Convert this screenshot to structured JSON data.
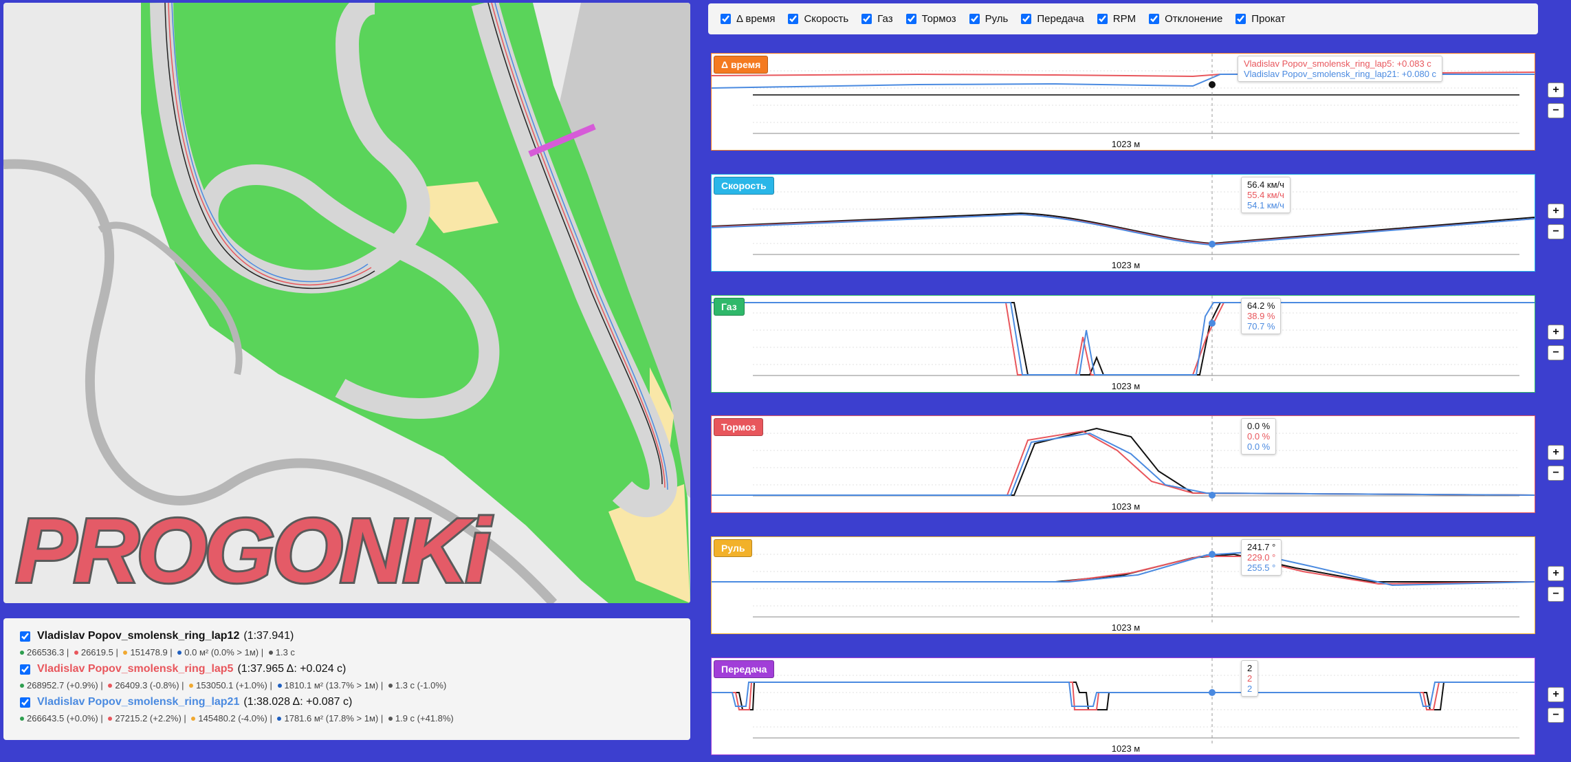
{
  "map": {
    "logo_text": "PROGONKi"
  },
  "laps": [
    {
      "name": "Vladislav Popov_smolensk_ring_lap12",
      "time": "(1:37.941)",
      "color": "#000000",
      "stats": [
        "266536.3",
        "26619.5",
        "151478.9",
        "0.0 м² (0.0% > 1м)",
        "1.3 с"
      ]
    },
    {
      "name": "Vladislav Popov_smolensk_ring_lap5",
      "time": "(1:37.965 Δ: +0.024 с)",
      "color": "#e8565c",
      "stats": [
        "268952.7 (+0.9%)",
        "26409.3 (-0.8%)",
        "153050.1 (+1.0%)",
        "1810.1 м² (13.7% > 1м)",
        "1.3 с (-1.0%)"
      ]
    },
    {
      "name": "Vladislav Popov_smolensk_ring_lap21",
      "time": "(1:38.028 Δ: +0.087 с)",
      "color": "#4a8ae0",
      "stats": [
        "266643.5 (+0.0%)",
        "27215.2 (+2.2%)",
        "145480.2 (-4.0%)",
        "1781.6 м² (17.8% > 1м)",
        "1.9 с (+41.8%)"
      ]
    }
  ],
  "stat_dot_colors": [
    "#2e9e4f",
    "#e8565c",
    "#f0a830",
    "#1f5fbf",
    "#555555"
  ],
  "toolbar": {
    "toggles": [
      "Δ время",
      "Скорость",
      "Газ",
      "Тормоз",
      "Руль",
      "Передача",
      "RPM",
      "Отклонение",
      "Прокат"
    ]
  },
  "x_marker": "1023 м",
  "charts": [
    {
      "title": "Δ время",
      "color": "#f47a20",
      "tooltip": [
        "Vladislav Popov_smolensk_ring_lap5: +0.083 с",
        "Vladislav Popov_smolensk_ring_lap21: +0.080 с"
      ],
      "tooltip_colors": [
        "#e8565c",
        "#4a8ae0"
      ]
    },
    {
      "title": "Скорость",
      "color": "#29b6e8",
      "tooltip": [
        "56.4 км/ч",
        "55.4 км/ч",
        "54.1 км/ч"
      ],
      "tooltip_colors": [
        "#111111",
        "#e8565c",
        "#4a8ae0"
      ]
    },
    {
      "title": "Газ",
      "color": "#2fb86a",
      "tooltip": [
        "64.2 %",
        "38.9 %",
        "70.7 %"
      ],
      "tooltip_colors": [
        "#111111",
        "#e8565c",
        "#4a8ae0"
      ]
    },
    {
      "title": "Тормоз",
      "color": "#e8565c",
      "tooltip": [
        "0.0 %",
        "0.0 %",
        "0.0 %"
      ],
      "tooltip_colors": [
        "#111111",
        "#e8565c",
        "#4a8ae0"
      ]
    },
    {
      "title": "Руль",
      "color": "#f2b12a",
      "tooltip": [
        "241.7 °",
        "229.0 °",
        "255.5 °"
      ],
      "tooltip_colors": [
        "#111111",
        "#e8565c",
        "#4a8ae0"
      ]
    },
    {
      "title": "Передача",
      "color": "#a13ed8",
      "tooltip": [
        "2",
        "2",
        "2"
      ],
      "tooltip_colors": [
        "#111111",
        "#e8565c",
        "#4a8ae0"
      ]
    }
  ],
  "zoom": {
    "plus": "+",
    "minus": "−"
  }
}
